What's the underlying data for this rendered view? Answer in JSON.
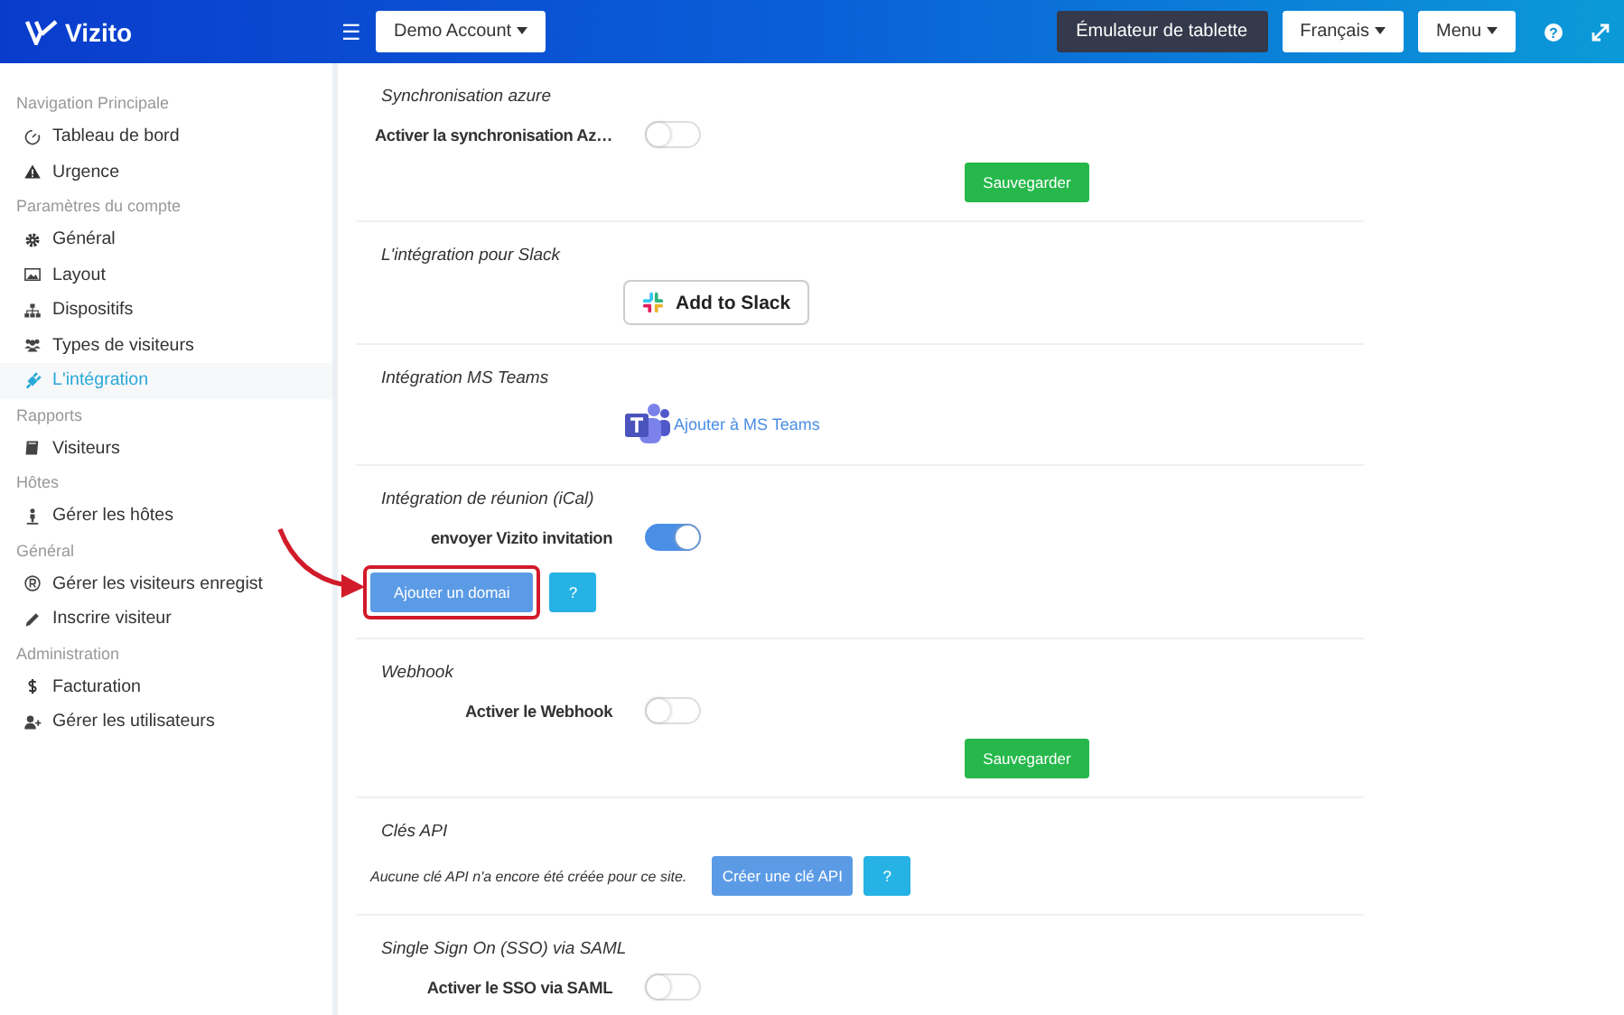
{
  "header": {
    "logo": "Vizito",
    "menu_icon": "☰",
    "account": "Demo Account",
    "help": "?",
    "buttons": [
      {
        "label": "Émulateur de tablette",
        "kind": "dark"
      },
      {
        "label": "Français",
        "kind": "dropdown"
      },
      {
        "label": "Menu",
        "kind": "dropdown"
      }
    ]
  },
  "sidebar": {
    "groups": [
      {
        "title": "Navigation Principale",
        "items": [
          {
            "label": "Tableau de bord",
            "kind": "gauge",
            "selected": false
          },
          {
            "label": "Urgence",
            "kind": "warning",
            "selected": false
          }
        ]
      },
      {
        "title": "Paramètres du compte",
        "items": [
          {
            "label": "Général",
            "kind": "gear",
            "selected": false
          },
          {
            "label": "Layout",
            "kind": "image",
            "selected": false
          },
          {
            "label": "Dispositifs",
            "kind": "sitemap",
            "selected": false
          },
          {
            "label": "Types de visiteurs",
            "kind": "users",
            "selected": false
          },
          {
            "label": "L'intégration",
            "kind": "plug",
            "selected": true
          }
        ]
      },
      {
        "title": "Rapports",
        "items": [
          {
            "label": "Visiteurs",
            "kind": "book",
            "selected": false
          }
        ]
      },
      {
        "title": "Hôtes",
        "items": [
          {
            "label": "Gérer les hôtes",
            "kind": "person",
            "selected": false
          }
        ]
      },
      {
        "title": "Général",
        "items": [
          {
            "label": "Gérer les visiteurs enregist",
            "kind": "registered",
            "selected": false
          },
          {
            "label": "Inscrire visiteur",
            "kind": "pencil",
            "selected": false
          }
        ]
      },
      {
        "title": "Administration",
        "items": [
          {
            "label": "Facturation",
            "kind": "dollar",
            "selected": false
          },
          {
            "label": "Gérer les utilisateurs",
            "kind": "user-plus",
            "selected": false
          }
        ]
      }
    ]
  },
  "sections": [
    {
      "title": "Synchronisation azure",
      "items": [
        {
          "kind": "toggle",
          "label": "Activer la synchronisation Az…",
          "on": false
        },
        {
          "kind": "save",
          "label": "Sauvegarder"
        }
      ]
    },
    {
      "title": "L'intégration pour Slack",
      "items": [
        {
          "kind": "slack",
          "label": "Add to Slack"
        }
      ]
    },
    {
      "title": "Intégration MS Teams",
      "items": [
        {
          "kind": "teams",
          "label": "Ajouter à MS Teams"
        }
      ]
    },
    {
      "title": "Intégration de réunion (iCal)",
      "items": [
        {
          "kind": "toggle",
          "label": "envoyer Vizito invitation",
          "on": true
        },
        {
          "kind": "buttons",
          "label": "Ajouter un domai",
          "help": "?",
          "highlighted": true
        }
      ]
    },
    {
      "title": "Webhook",
      "items": [
        {
          "kind": "toggle",
          "label": "Activer le Webhook",
          "on": false
        },
        {
          "kind": "save",
          "label": "Sauvegarder"
        }
      ]
    },
    {
      "title": "Clés API",
      "items": [
        {
          "kind": "buttons",
          "note": "Aucune clé API n'a encore été créée pour ce site.",
          "label": "Créer une clé API",
          "help": "?",
          "highlighted": false
        }
      ]
    },
    {
      "title": "Single Sign On (SSO) via SAML",
      "items": [
        {
          "kind": "toggle",
          "label": "Activer le SSO via SAML",
          "on": false
        }
      ]
    }
  ]
}
